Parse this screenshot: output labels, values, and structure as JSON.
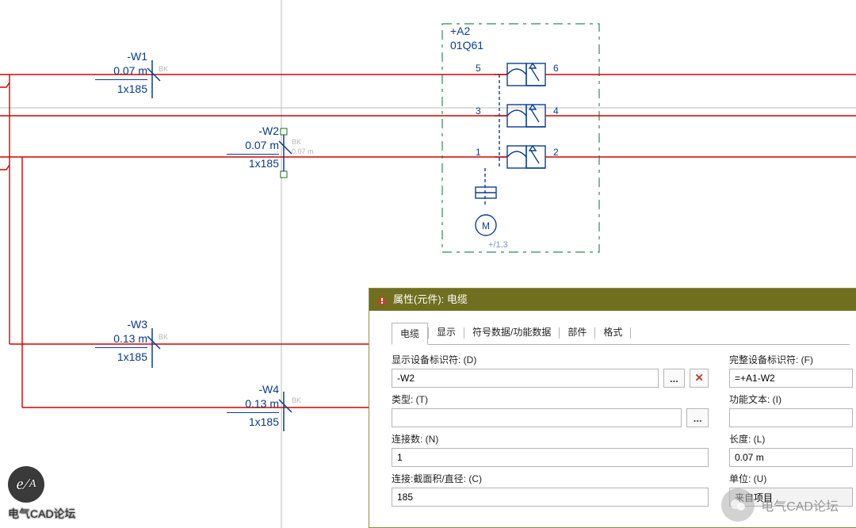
{
  "component": {
    "box_ref": "+A2",
    "device_tag": "01Q61",
    "bottom_ref": "+/1.3",
    "terminals": {
      "t1": "1",
      "t2": "2",
      "t3": "3",
      "t4": "4",
      "t5": "5",
      "t6": "6"
    },
    "motor_icon": "M"
  },
  "cables": {
    "w1": {
      "name": "-W1",
      "len": "0.07 m",
      "spec": "1x185",
      "bk": "BK"
    },
    "w2": {
      "name": "-W2",
      "len": "0.07 m",
      "spec": "1x185",
      "bk": "BK",
      "bk2": "0.07 m"
    },
    "w3": {
      "name": "-W3",
      "len": "0.13 m",
      "spec": "1x185",
      "bk": "BK"
    },
    "w4": {
      "name": "-W4",
      "len": "0.13 m",
      "spec": "1x185",
      "bk": "BK"
    }
  },
  "panel": {
    "title": "属性(元件): 电缆",
    "tabs": {
      "t1": "电缆",
      "t2": "显示",
      "t3": "符号数据/功能数据",
      "t4": "部件",
      "t5": "格式"
    },
    "labels": {
      "disp_id": "显示设备标识符: (D)",
      "full_id": "完整设备标识符: (F)",
      "type": "类型: (T)",
      "func_text": "功能文本: (I)",
      "conn_count": "连接数: (N)",
      "length": "长度: (L)",
      "cross": "连接:截面积/直径: (C)",
      "unit": "单位: (U)"
    },
    "values": {
      "disp_id": "-W2",
      "full_id": "=+A1-W2",
      "type": "",
      "func_text": "",
      "conn_count": "1",
      "length": "0.07 m",
      "cross": "185",
      "unit": "来自项目"
    },
    "ellipsis": "...",
    "del": "✕"
  },
  "logo_text": "电气CAD论坛",
  "wm_text": "电气CAD论坛"
}
